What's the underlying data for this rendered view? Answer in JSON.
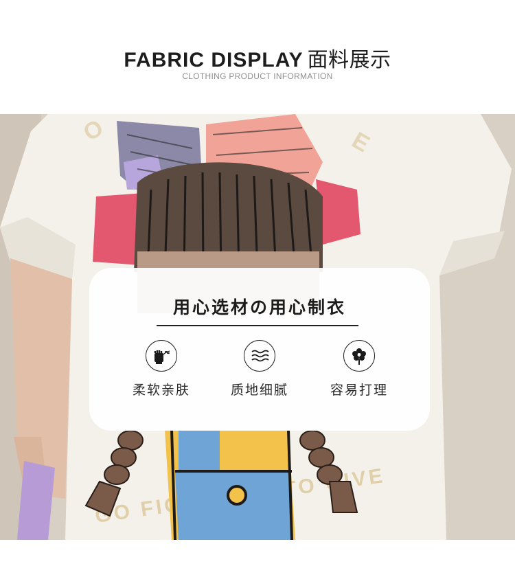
{
  "header": {
    "title_en": "FABRIC DISPLAY",
    "title_zh": "面料展示",
    "subtitle": "CLOTHING PRODUCT INFORMATION"
  },
  "photo": {
    "shirt_print_text_bottom": "GO FIGHT NOT TO GIVE"
  },
  "card": {
    "title": "用心选材の用心制衣",
    "features": [
      {
        "icon": "fist-leaf-icon",
        "label": "柔软亲肤"
      },
      {
        "icon": "wave-icon",
        "label": "质地细腻"
      },
      {
        "icon": "flower-icon",
        "label": "容易打理"
      }
    ]
  },
  "colors": {
    "background": "#ffffff",
    "wall": "#d8d0c4",
    "shirt": "#f4f1ea",
    "text_dark": "#1d1d1d",
    "subtitle_gray": "#8f8f8f"
  }
}
